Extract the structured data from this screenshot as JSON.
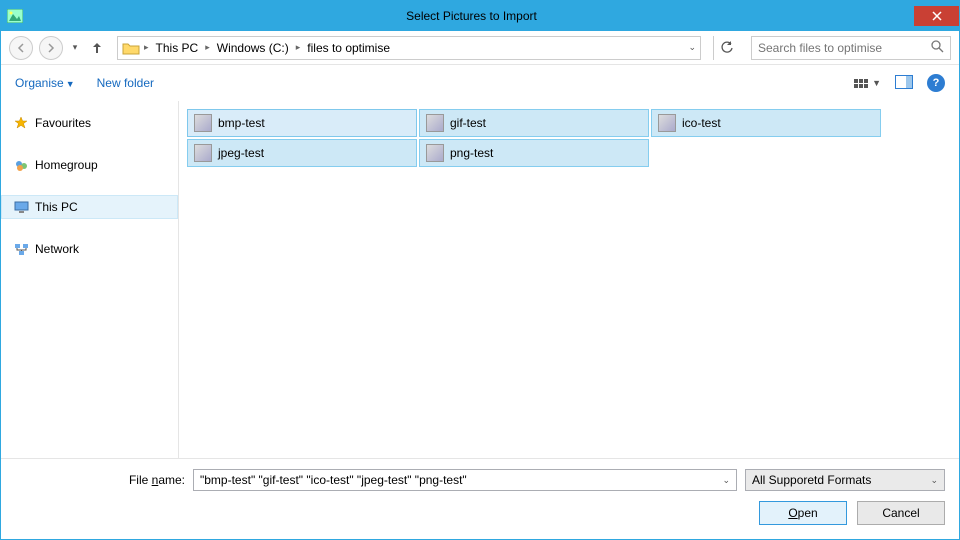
{
  "title": "Select Pictures to Import",
  "nav": {
    "breadcrumbs": [
      "This PC",
      "Windows (C:)",
      "files to optimise"
    ],
    "search_placeholder": "Search files to optimise"
  },
  "toolbar": {
    "organise": "Organise",
    "new_folder": "New folder"
  },
  "tree": {
    "favourites": "Favourites",
    "homegroup": "Homegroup",
    "this_pc": "This PC",
    "network": "Network"
  },
  "files": [
    {
      "name": "bmp-test"
    },
    {
      "name": "gif-test"
    },
    {
      "name": "ico-test"
    },
    {
      "name": "jpeg-test"
    },
    {
      "name": "png-test"
    }
  ],
  "bottom": {
    "label_file": "File ",
    "label_name": "n",
    "label_ame": "ame:",
    "filename_value": "\"bmp-test\" \"gif-test\" \"ico-test\" \"jpeg-test\" \"png-test\"",
    "filter": "All Supporetd Formats",
    "open_pre": "O",
    "open_post": "pen",
    "cancel": "Cancel"
  }
}
